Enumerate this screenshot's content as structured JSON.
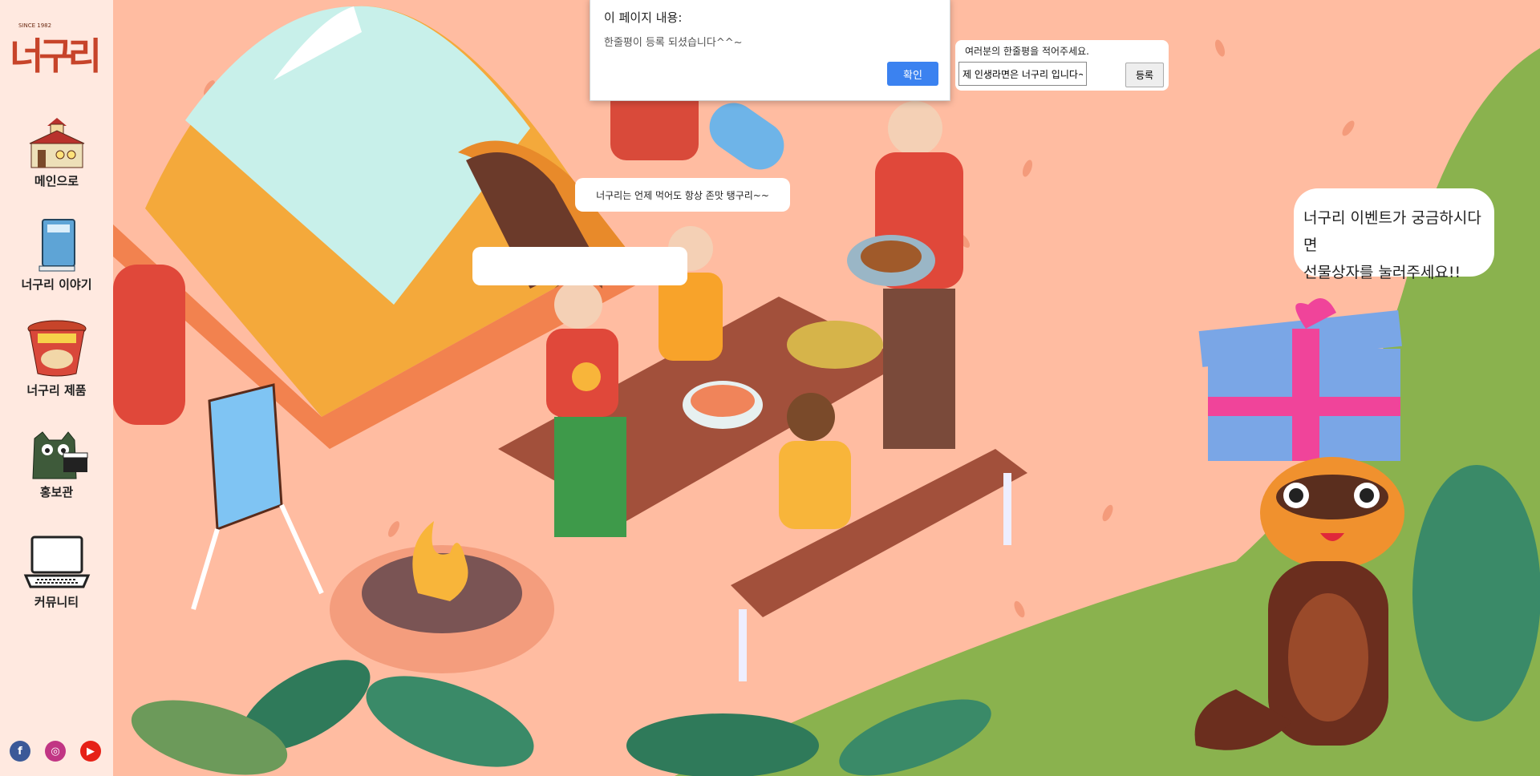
{
  "sidebar": {
    "logo": {
      "since": "SINCE 1982",
      "text": "너구리"
    },
    "items": [
      {
        "label": "메인으로",
        "icon": "house-icon"
      },
      {
        "label": "너구리 이야기",
        "icon": "book-icon"
      },
      {
        "label": "너구리 제품",
        "icon": "noodle-cup-icon"
      },
      {
        "label": "홍보관",
        "icon": "raccoon-clapper-icon"
      },
      {
        "label": "커뮤니티",
        "icon": "laptop-icon"
      }
    ],
    "social": [
      {
        "name": "facebook-icon",
        "glyph": "f",
        "color": "#3b5998"
      },
      {
        "name": "instagram-icon",
        "glyph": "◎",
        "color": "#c13584"
      },
      {
        "name": "youtube-icon",
        "glyph": "▶",
        "color": "#e62117"
      }
    ]
  },
  "dialog": {
    "title": "이 페이지 내용:",
    "message": "한줄평이 등록 되셨습니다^^~",
    "ok_label": "확인"
  },
  "review": {
    "title": "여러분의 한줄평을 적어주세요.",
    "input_value": "제 인생라면은 너구리 입니다~",
    "submit_label": "등록"
  },
  "bubbles": {
    "tent_text": "너구리는 언제 먹어도 항상 존맛 탱구리~~",
    "empty_text": "",
    "event_line1": "너구리 이벤트가 궁금하시다면",
    "event_line2": "선물상자를 눌러주세요!!"
  },
  "colors": {
    "background": "#ffbca1",
    "sidebar": "#ffe9e0",
    "accent": "#3b82f0",
    "grass": "#8ab24e"
  }
}
